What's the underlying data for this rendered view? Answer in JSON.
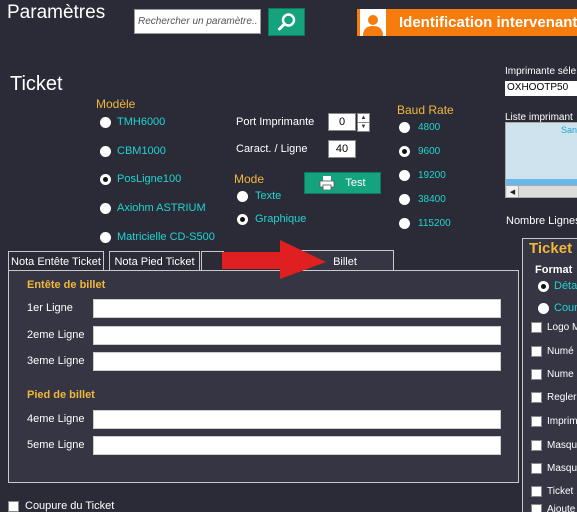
{
  "header": {
    "title": "Paramètres",
    "search_placeholder": "Rechercher un paramètre...",
    "ident_label": "Identification intervenant"
  },
  "ticket": {
    "title": "Ticket",
    "modele_label": "Modèle",
    "models": [
      "TMH6000",
      "CBM1000",
      "PosLigne100",
      "Axiohm ASTRIUM",
      "Matricielle CD-S500"
    ],
    "selected_model": "PosLigne100",
    "port_label": "Port Imprimante",
    "port_value": "0",
    "caract_label": "Caract. / Ligne",
    "caract_value": "40",
    "mode_label": "Mode",
    "modes": [
      "Texte",
      "Graphique"
    ],
    "selected_mode": "Graphique",
    "test_label": "Test",
    "baud_label": "Baud Rate",
    "bauds": [
      "4800",
      "9600",
      "19200",
      "38400",
      "115200"
    ],
    "selected_baud": "9600"
  },
  "printer": {
    "selected_label": "Imprimante séle",
    "selected_value": "OXHOOTP50",
    "list_label": "Liste imprimant",
    "list_item": "San",
    "nb_lignes_label": "Nombre Lignes"
  },
  "tabs": [
    "Nota Entête Ticket",
    "Nota Pied Ticket",
    "Billet"
  ],
  "active_tab": "Billet",
  "billet": {
    "entete_label": "Entête de billet",
    "entete_lines": [
      "1er Ligne",
      "2eme Ligne",
      "3eme Ligne"
    ],
    "pied_label": "Pied de billet",
    "pied_lines": [
      "4eme Ligne",
      "5eme Ligne"
    ]
  },
  "coupure_label": "Coupure du Ticket",
  "ticket_right": {
    "title": "Ticket",
    "format_label": "Format",
    "format_opt1": "Déta",
    "format_opt2": "Cour",
    "checks": [
      "Logo M",
      "Numé",
      "Nume",
      "Regler",
      "Imprim",
      "Masqu",
      "Masqu",
      "Ticket",
      "Ajoute"
    ]
  },
  "colors": {
    "accent_cyan": "#1fd5d0",
    "accent_gold": "#f0b83c",
    "green_btn": "#15a37e",
    "orange_btn": "#f57c0d",
    "arrow_red": "#e02020"
  }
}
